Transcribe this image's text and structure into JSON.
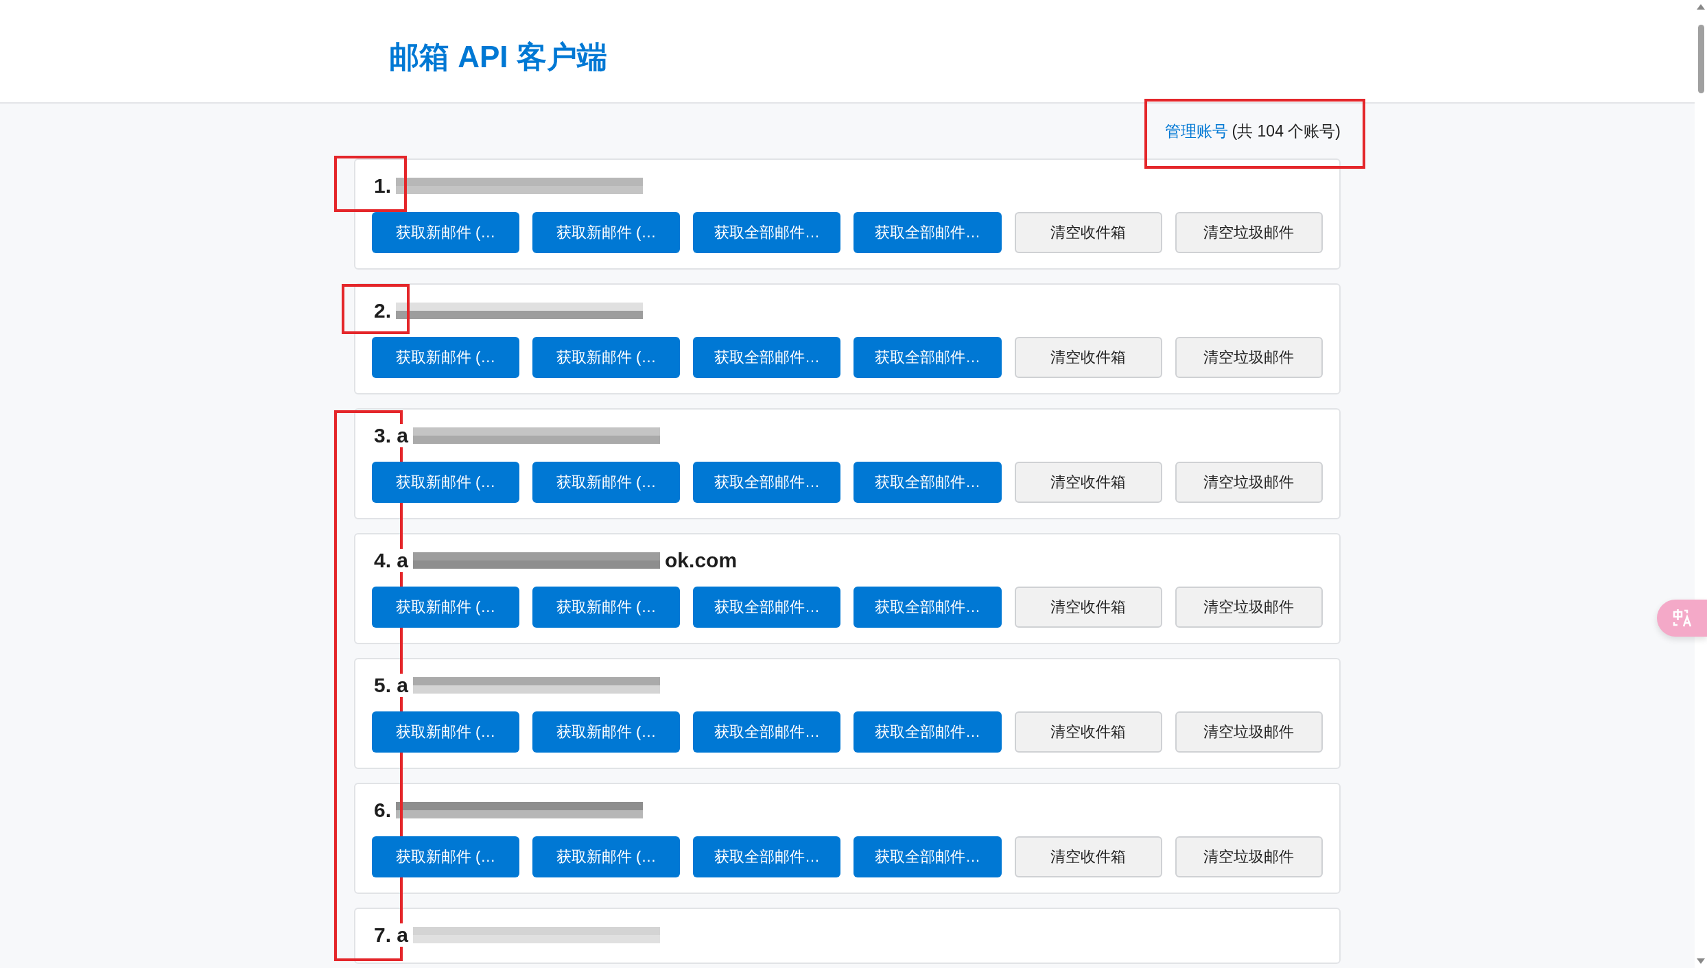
{
  "header": {
    "title": "邮箱 API 客户端"
  },
  "summary": {
    "link": "管理账号",
    "count": "(共 104 个账号)"
  },
  "accounts": [
    {
      "label": "1.",
      "buttons": [
        {
          "label": "获取新邮件 (…",
          "kind": "primary"
        },
        {
          "label": "获取新邮件 (…",
          "kind": "primary"
        },
        {
          "label": "获取全部邮件…",
          "kind": "primary"
        },
        {
          "label": "获取全部邮件…",
          "kind": "primary"
        },
        {
          "label": "清空收件箱",
          "kind": "secondary"
        },
        {
          "label": "清空垃圾邮件",
          "kind": "secondary"
        }
      ]
    },
    {
      "label": "2.",
      "buttons": [
        {
          "label": "获取新邮件 (…",
          "kind": "primary"
        },
        {
          "label": "获取新邮件 (…",
          "kind": "primary"
        },
        {
          "label": "获取全部邮件…",
          "kind": "primary"
        },
        {
          "label": "获取全部邮件…",
          "kind": "primary"
        },
        {
          "label": "清空收件箱",
          "kind": "secondary"
        },
        {
          "label": "清空垃圾邮件",
          "kind": "secondary"
        }
      ]
    },
    {
      "label": "3. a",
      "buttons": [
        {
          "label": "获取新邮件 (…",
          "kind": "primary"
        },
        {
          "label": "获取新邮件 (…",
          "kind": "primary"
        },
        {
          "label": "获取全部邮件…",
          "kind": "primary"
        },
        {
          "label": "获取全部邮件…",
          "kind": "primary"
        },
        {
          "label": "清空收件箱",
          "kind": "secondary"
        },
        {
          "label": "清空垃圾邮件",
          "kind": "secondary"
        }
      ]
    },
    {
      "label": "4. a",
      "tail": "ok.com",
      "buttons": [
        {
          "label": "获取新邮件 (…",
          "kind": "primary"
        },
        {
          "label": "获取新邮件 (…",
          "kind": "primary"
        },
        {
          "label": "获取全部邮件…",
          "kind": "primary"
        },
        {
          "label": "获取全部邮件…",
          "kind": "primary"
        },
        {
          "label": "清空收件箱",
          "kind": "secondary"
        },
        {
          "label": "清空垃圾邮件",
          "kind": "secondary"
        }
      ]
    },
    {
      "label": "5. a",
      "buttons": [
        {
          "label": "获取新邮件 (…",
          "kind": "primary"
        },
        {
          "label": "获取新邮件 (…",
          "kind": "primary"
        },
        {
          "label": "获取全部邮件…",
          "kind": "primary"
        },
        {
          "label": "获取全部邮件…",
          "kind": "primary"
        },
        {
          "label": "清空收件箱",
          "kind": "secondary"
        },
        {
          "label": "清空垃圾邮件",
          "kind": "secondary"
        }
      ]
    },
    {
      "label": "6.",
      "buttons": [
        {
          "label": "获取新邮件 (…",
          "kind": "primary"
        },
        {
          "label": "获取新邮件 (…",
          "kind": "primary"
        },
        {
          "label": "获取全部邮件…",
          "kind": "primary"
        },
        {
          "label": "获取全部邮件…",
          "kind": "primary"
        },
        {
          "label": "清空收件箱",
          "kind": "secondary"
        },
        {
          "label": "清空垃圾邮件",
          "kind": "secondary"
        }
      ]
    },
    {
      "label": "7. a"
    }
  ],
  "annotations": [
    {
      "kind": "box",
      "color": "#e4262a"
    },
    {
      "kind": "box",
      "color": "#e4262a"
    },
    {
      "kind": "box",
      "color": "#e4262a"
    },
    {
      "kind": "box",
      "color": "#e4262a"
    }
  ]
}
